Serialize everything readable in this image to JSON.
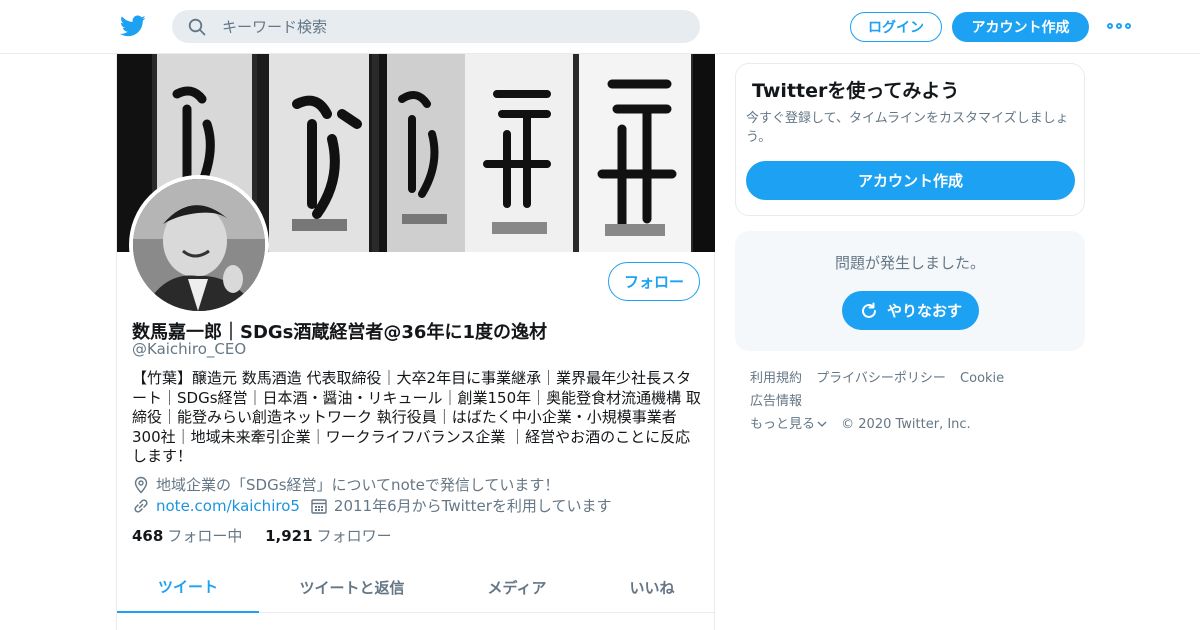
{
  "header": {
    "logo_icon": "twitter-bird-icon",
    "search_placeholder": "キーワード検索",
    "login_label": "ログイン",
    "signup_label": "アカウント作成",
    "more_icon": "more-dots-icon"
  },
  "profile": {
    "banner_alt": "sake-bottles-banner",
    "follow_label": "フォロー",
    "name": "数馬嘉一郎｜SDGs酒蔵経営者@36年に1度の逸材",
    "handle": "@Kaichiro_CEO",
    "bio": "【竹葉】醸造元 数馬酒造 代表取締役｜大卒2年目に事業継承｜業界最年少社長スタート｜SDGs経営｜日本酒・醤油・リキュール｜創業150年｜奥能登食材流通機構 取締役｜能登みらい創造ネットワーク 執行役員｜はばたく中小企業・小規模事業者300社｜地域未来牽引企業｜ワークライフバランス企業 ｜経営やお酒のことに反応します！",
    "location": "地域企業の「SDGs経営」についてnoteで発信しています！",
    "url": "note.com/kaichiro5",
    "joined": "2011年6月からTwitterを利用しています",
    "following_count": "468",
    "following_label": "フォロー中",
    "followers_count": "1,921",
    "followers_label": "フォロワー",
    "tabs": [
      {
        "label": "ツイート"
      },
      {
        "label": "ツイートと返信"
      },
      {
        "label": "メディア"
      },
      {
        "label": "いいね"
      }
    ]
  },
  "sidebar": {
    "signup_title": "Twitterを使ってみよう",
    "signup_desc": "今すぐ登録して、タイムラインをカスタマイズしましょう。",
    "signup_button": "アカウント作成",
    "error_message": "問題が発生しました。",
    "retry_label": "やりなおす"
  },
  "footer": {
    "links": [
      "利用規約",
      "プライバシーポリシー",
      "Cookie",
      "広告情報"
    ],
    "more": "もっと見る",
    "copyright": "© 2020 Twitter, Inc."
  },
  "colors": {
    "accent": "#1da1f2",
    "text_secondary": "#657786",
    "border": "#e6ecf0"
  }
}
